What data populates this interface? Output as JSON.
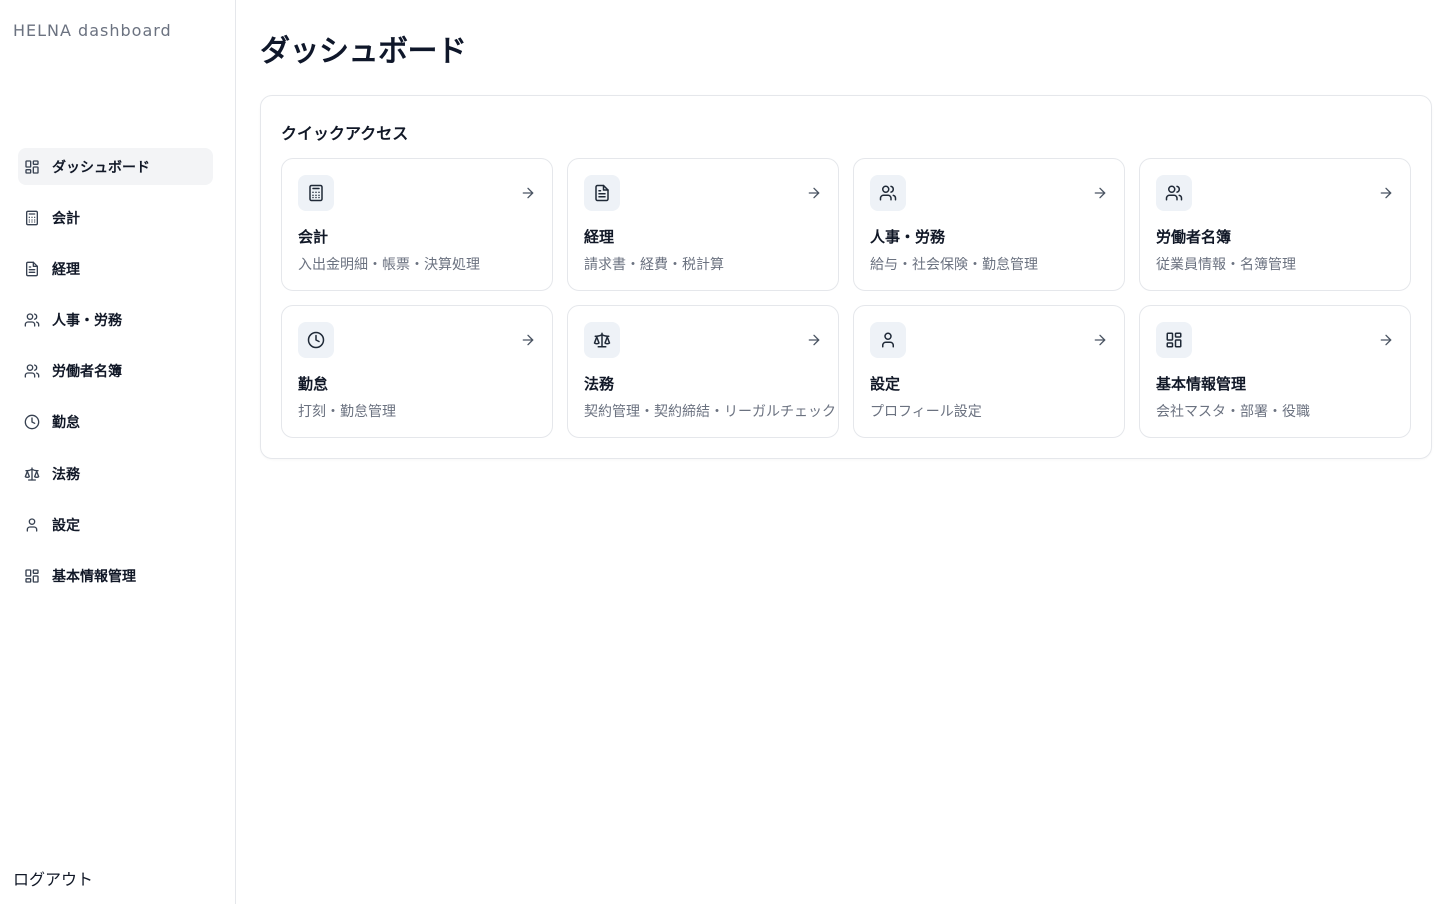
{
  "app": {
    "brand": "HELNA dashboard"
  },
  "sidebar": {
    "items": [
      {
        "label": "ダッシュボード",
        "icon": "dashboard-grid-icon",
        "active": true
      },
      {
        "label": "会計",
        "icon": "calculator-icon"
      },
      {
        "label": "経理",
        "icon": "file-text-icon"
      },
      {
        "label": "人事・労務",
        "icon": "users-icon"
      },
      {
        "label": "労働者名簿",
        "icon": "users-icon"
      },
      {
        "label": "勤怠",
        "icon": "clock-icon"
      },
      {
        "label": "法務",
        "icon": "scale-icon"
      },
      {
        "label": "設定",
        "icon": "user-icon"
      },
      {
        "label": "基本情報管理",
        "icon": "dashboard-grid-icon"
      }
    ],
    "logout_label": "ログアウト"
  },
  "main": {
    "page_title": "ダッシュボード",
    "quick_access": {
      "title": "クイックアクセス",
      "cards": [
        {
          "title": "会計",
          "desc": "入出金明細・帳票・決算処理",
          "icon": "calculator-icon"
        },
        {
          "title": "経理",
          "desc": "請求書・経費・税計算",
          "icon": "file-text-icon"
        },
        {
          "title": "人事・労務",
          "desc": "給与・社会保険・勤怠管理",
          "icon": "users-icon"
        },
        {
          "title": "労働者名簿",
          "desc": "従業員情報・名簿管理",
          "icon": "users-icon"
        },
        {
          "title": "勤怠",
          "desc": "打刻・勤怠管理",
          "icon": "clock-icon"
        },
        {
          "title": "法務",
          "desc": "契約管理・契約締結・リーガルチェック",
          "icon": "scale-icon"
        },
        {
          "title": "設定",
          "desc": "プロフィール設定",
          "icon": "user-icon"
        },
        {
          "title": "基本情報管理",
          "desc": "会社マスタ・部署・役職",
          "icon": "dashboard-grid-icon"
        }
      ]
    }
  }
}
